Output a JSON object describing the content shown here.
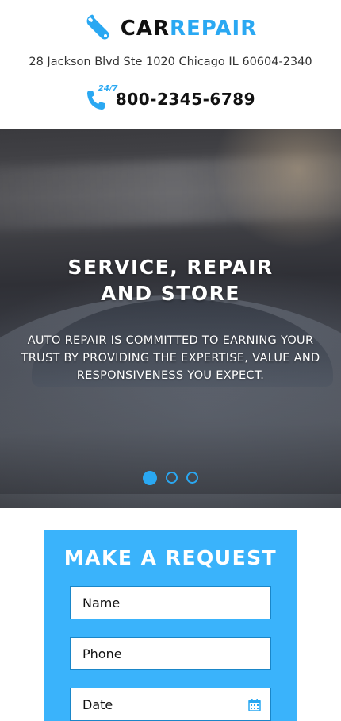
{
  "header": {
    "logo_part1": "CAR",
    "logo_part2": "REPAIR",
    "address": "28 Jackson Blvd Ste 1020 Chicago IL 60604-2340",
    "hours_tag": "24/7",
    "phone": "800-2345-6789"
  },
  "hero": {
    "title_line1": "SERVICE, REPAIR",
    "title_line2": "AND STORE",
    "subtitle": "AUTO REPAIR IS COMMITTED TO EARNING YOUR TRUST BY PROVIDING THE EXPERTISE, VALUE AND RESPONSIVENESS YOU EXPECT.",
    "slides_count": 3,
    "active_slide": 1
  },
  "request_form": {
    "title": "MAKE A REQUEST",
    "name_placeholder": "Name",
    "phone_placeholder": "Phone",
    "date_placeholder": "Date"
  },
  "colors": {
    "accent": "#2aa8f2",
    "form_bg": "#3ab3fb"
  },
  "icons": {
    "logo": "wrench-icon",
    "phone": "phone-icon",
    "date": "calendar-icon"
  }
}
